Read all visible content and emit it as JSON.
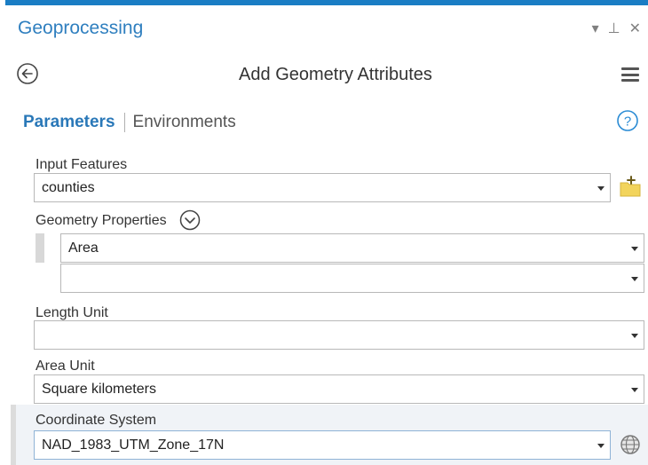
{
  "window": {
    "title": "Geoprocessing",
    "controls": {
      "dropdown": "▾",
      "pin": "⊥",
      "close": "✕"
    }
  },
  "tool": {
    "title": "Add Geometry Attributes"
  },
  "tabs": [
    {
      "label": "Parameters",
      "active": true
    },
    {
      "label": "Environments",
      "active": false
    }
  ],
  "parameters": {
    "input_features": {
      "label": "Input Features",
      "value": "counties"
    },
    "geometry_properties": {
      "label": "Geometry Properties",
      "values": [
        "Area",
        ""
      ]
    },
    "length_unit": {
      "label": "Length Unit",
      "value": ""
    },
    "area_unit": {
      "label": "Area Unit",
      "value": "Square kilometers"
    },
    "coordinate_system": {
      "label": "Coordinate System",
      "value": "NAD_1983_UTM_Zone_17N"
    }
  },
  "colors": {
    "accent": "#1a7dc4",
    "title_blue": "#2f7fbf",
    "folder_yellow": "#f2d45c"
  }
}
